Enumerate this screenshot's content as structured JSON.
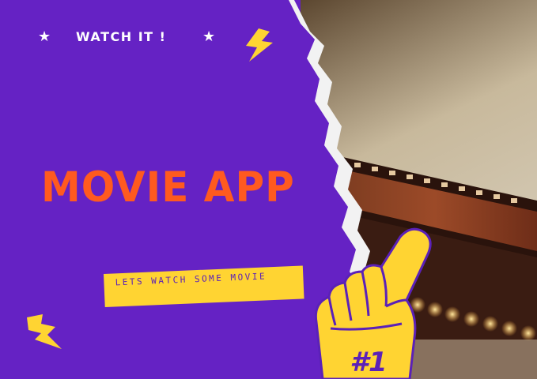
{
  "header": {
    "star_left_icon": "star-icon",
    "title": "WATCH IT !",
    "star_right_icon": "star-icon"
  },
  "hero": {
    "title": "MOVIE APP",
    "tagline": "LETS WATCH SOME MOVIE"
  },
  "foam_hand": {
    "badge": "#1"
  },
  "colors": {
    "background_purple": "#6522c4",
    "title_orange": "#ff5a1f",
    "accent_yellow": "#ffd432",
    "tagline_text": "#5b21b8"
  },
  "icons": [
    "star-icon",
    "lightning-bolt-icon",
    "foam-finger-icon"
  ]
}
